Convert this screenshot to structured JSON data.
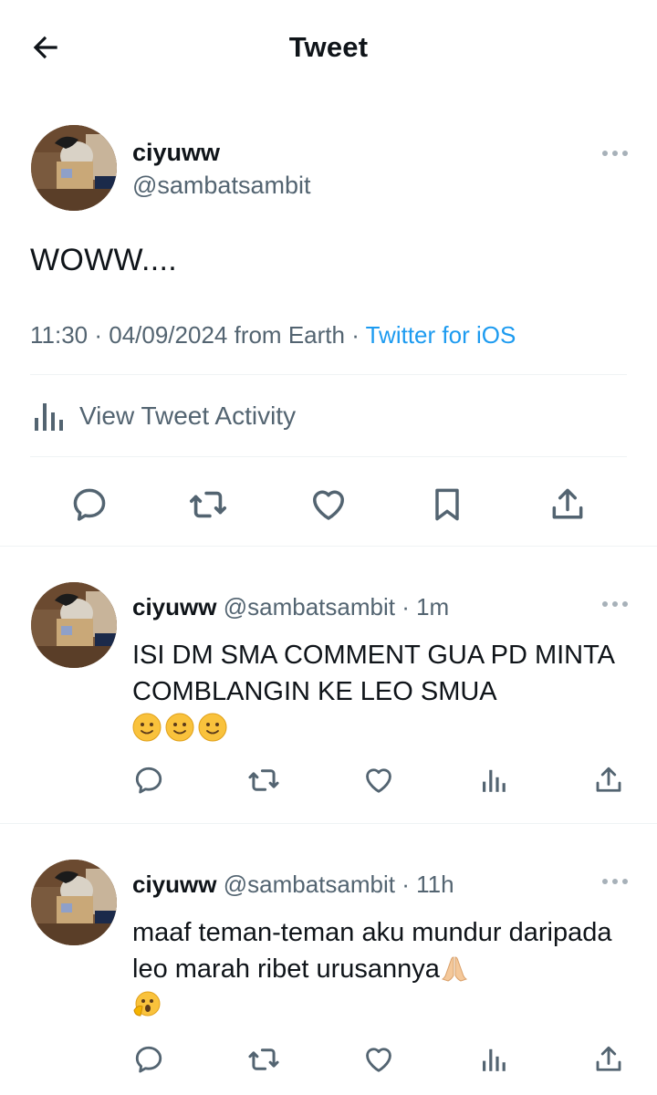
{
  "header": {
    "title": "Tweet"
  },
  "main_tweet": {
    "name": "ciyuww",
    "handle": "@sambatsambit",
    "text": "WOWW....",
    "meta": "11:30 · 04/09/2024 from Earth",
    "source_sep": " · ",
    "source": "Twitter for iOS",
    "activity_label": "View Tweet Activity"
  },
  "replies": [
    {
      "name": "ciyuww",
      "handle": "@sambatsambit",
      "dot": "·",
      "time": "1m",
      "text": "ISI DM SMA COMMENT GUA PD MINTA COMBLANGIN KE LEO SMUA",
      "emojis": [
        "slightly-smiling-face",
        "slightly-smiling-face",
        "slightly-smiling-face"
      ]
    },
    {
      "name": "ciyuww",
      "handle": "@sambatsambit",
      "dot": "·",
      "time": "11h",
      "text": "maaf teman-teman aku mundur daripada leo marah ribet urusannya",
      "emojis": [
        "folded-hands",
        "face-with-open-mouth-and-hand"
      ]
    }
  ],
  "colors": {
    "text": "#0f1419",
    "secondary": "#536471",
    "link": "#1d9bf0",
    "divider": "#eff3f4"
  }
}
